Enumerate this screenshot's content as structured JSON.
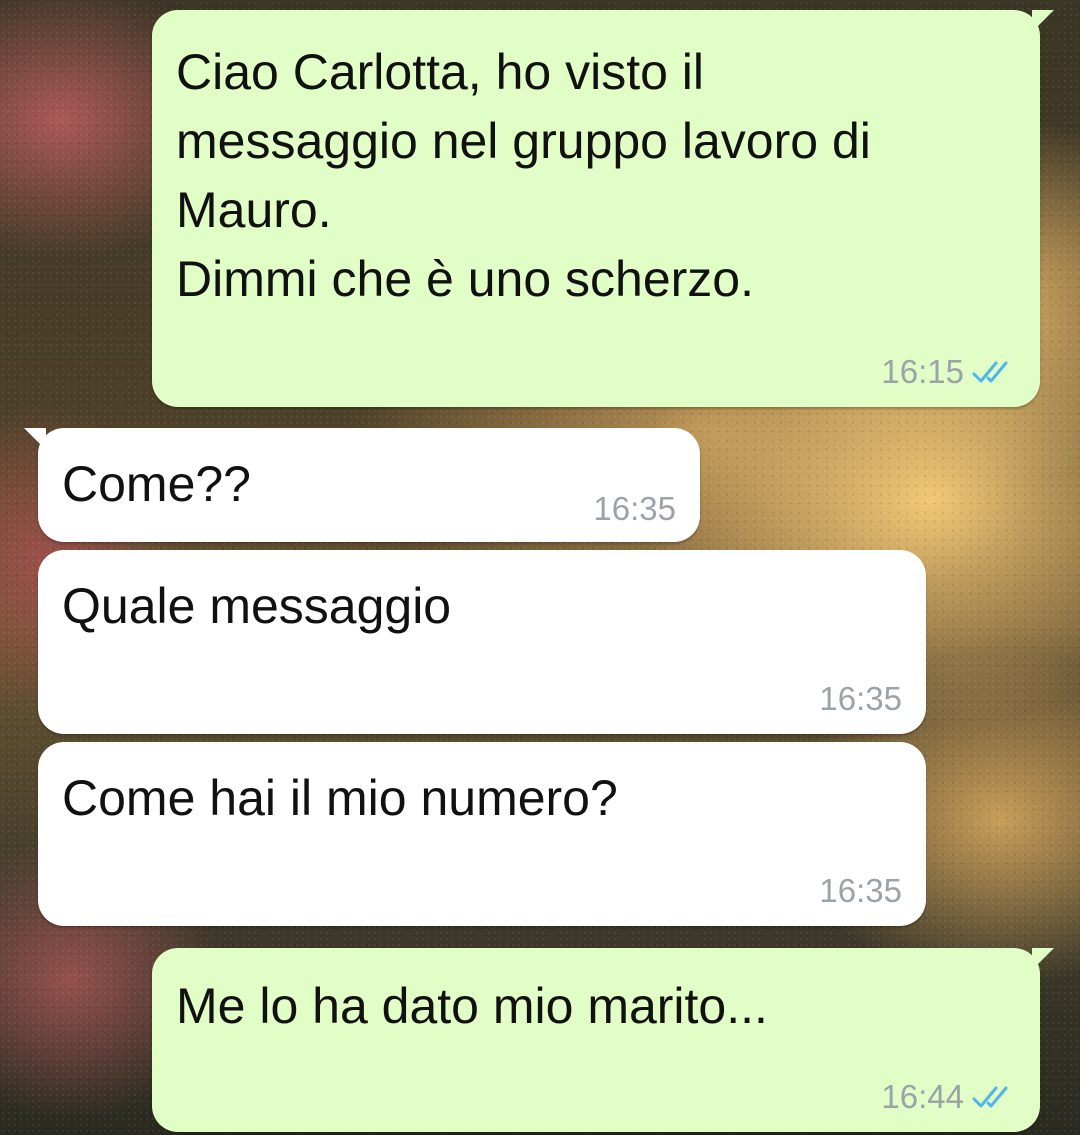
{
  "messages": [
    {
      "direction": "outgoing",
      "text": "Ciao Carlotta, ho visto il\nmessaggio nel gruppo lavoro di\nMauro.\nDimmi che è uno scherzo.",
      "time": "16:15",
      "status_icon": "double-check-read-icon"
    },
    {
      "direction": "incoming",
      "text": "Come??",
      "time": "16:35"
    },
    {
      "direction": "incoming",
      "text": "Quale messaggio",
      "time": "16:35"
    },
    {
      "direction": "incoming",
      "text": "Come hai il mio numero?",
      "time": "16:35"
    },
    {
      "direction": "outgoing",
      "text": "Me lo ha dato mio marito...",
      "time": "16:44",
      "status_icon": "double-check-read-icon"
    }
  ],
  "colors": {
    "outgoing_bubble": "#e1fec6",
    "incoming_bubble": "#ffffff",
    "read_ticks": "#4fb6ec",
    "timestamp": "#9aa3a8"
  }
}
